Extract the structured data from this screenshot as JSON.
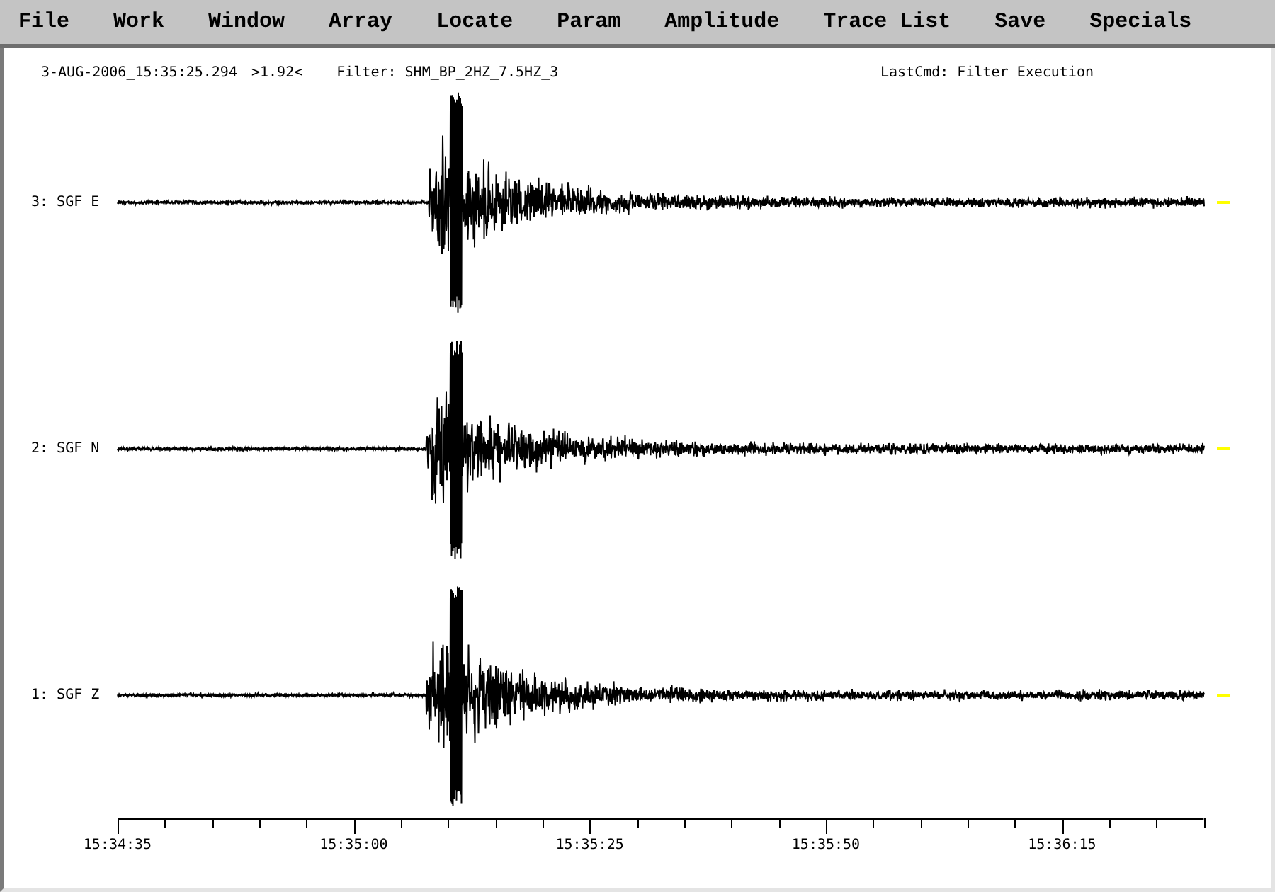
{
  "menu_bar": {
    "items": [
      "File",
      "Work",
      "Window",
      "Array",
      "Locate",
      "Param",
      "Amplitude",
      "Trace List",
      "Save",
      "Specials"
    ]
  },
  "header": {
    "timestamp": "3-AUG-2006_15:35:25.294",
    "scale": ">1.92<",
    "filter": "Filter: SHM_BP_2HZ_7.5HZ_3",
    "last_command": "LastCmd: Filter Execution"
  },
  "traces": [
    {
      "label": "3: SGF E"
    },
    {
      "label": "2: SGF N"
    },
    {
      "label": "1: SGF Z"
    }
  ],
  "time_axis": {
    "labels": [
      "15:34:35",
      "15:35:00",
      "15:35:25",
      "15:35:50",
      "15:36:15"
    ]
  }
}
